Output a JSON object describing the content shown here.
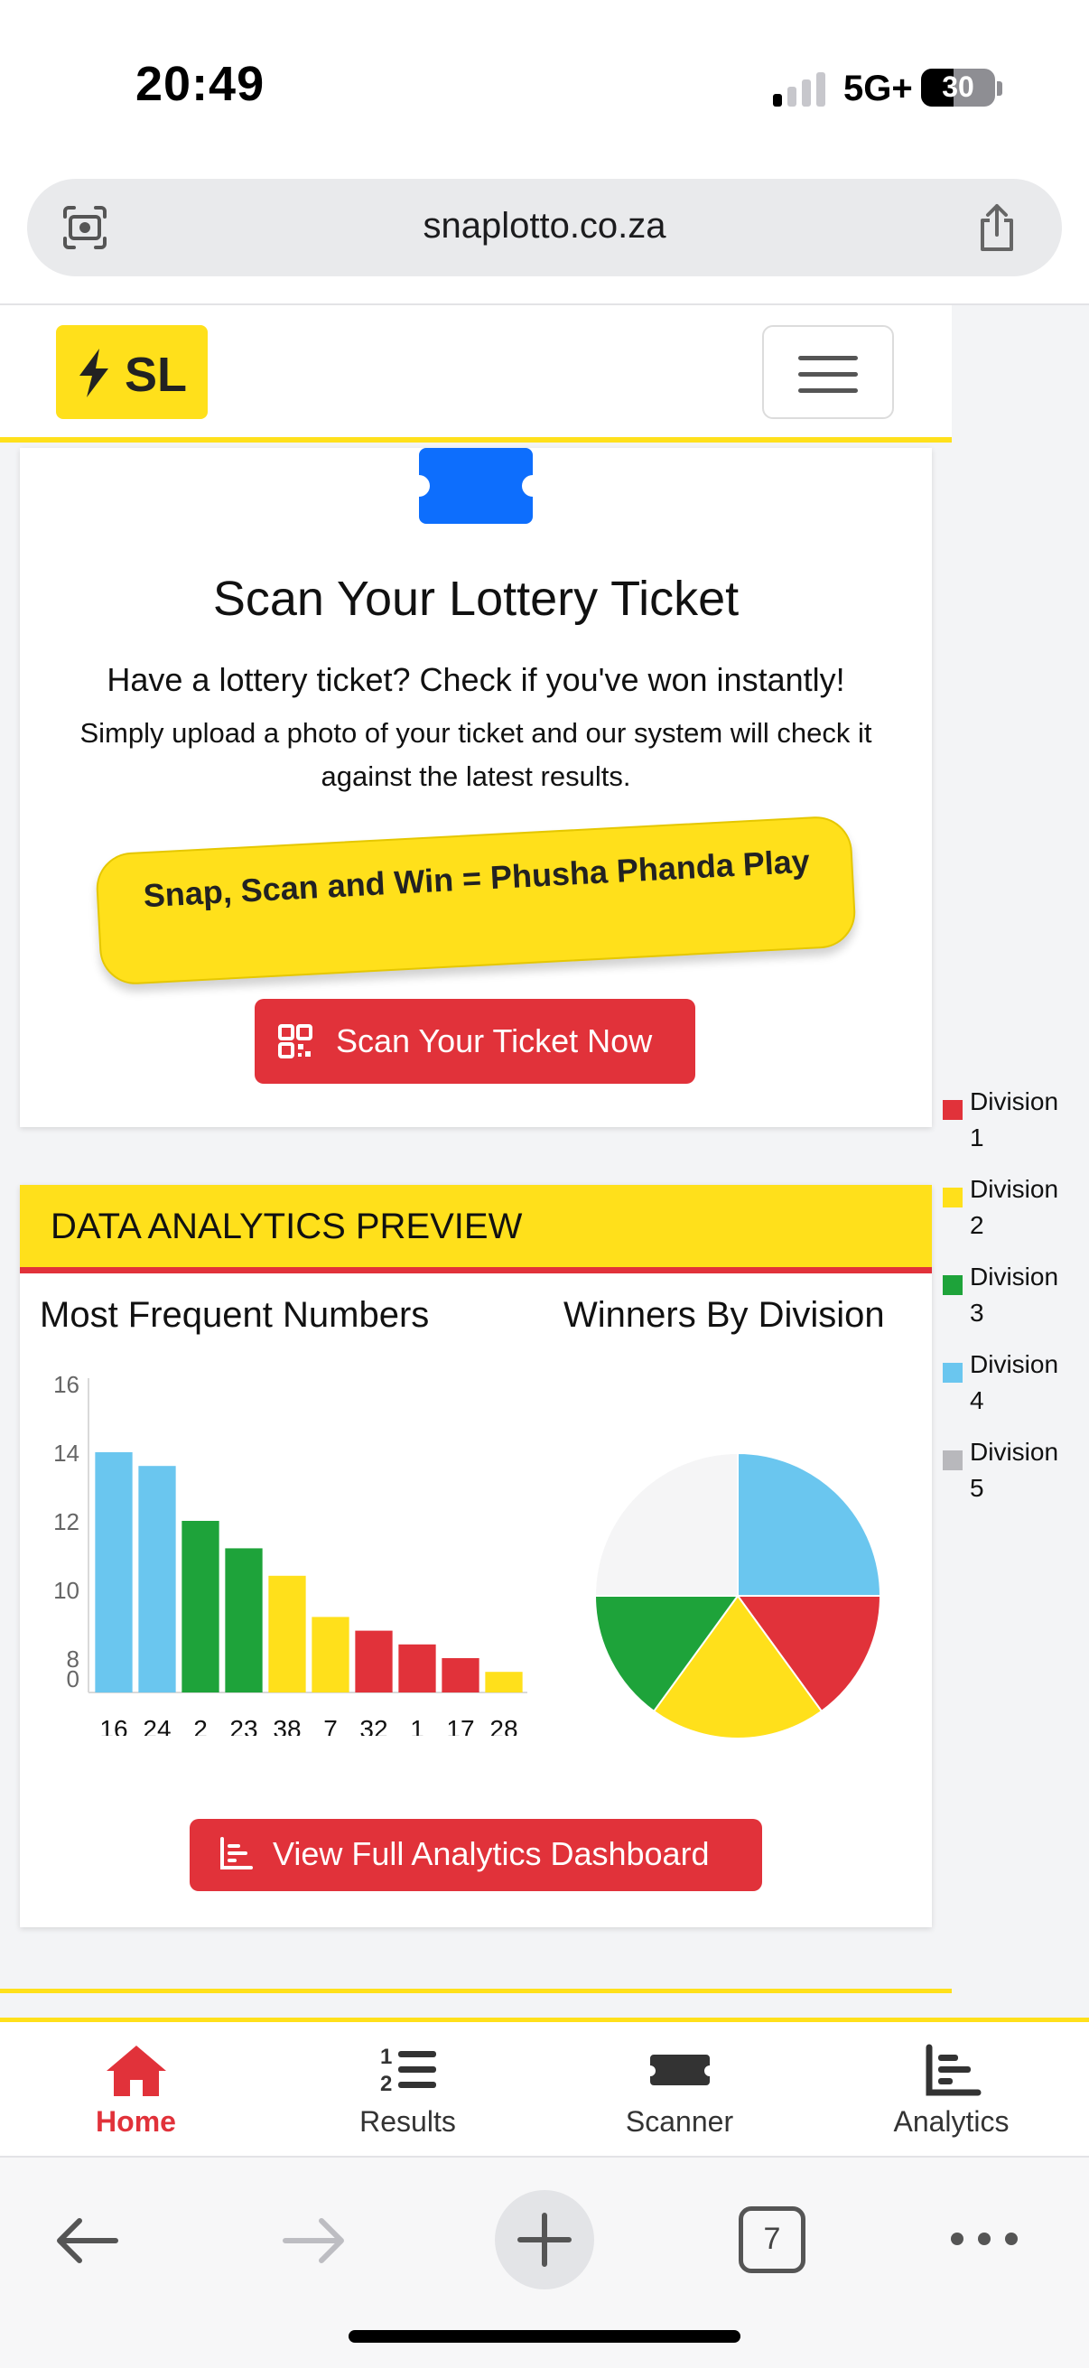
{
  "status_bar": {
    "time": "20:49",
    "network": "5G+",
    "battery": "30"
  },
  "browser": {
    "url": "snaplotto.co.za",
    "tab_count": "7",
    "icons": [
      "visual-search-icon",
      "share-icon",
      "back-arrow-icon",
      "forward-arrow-icon",
      "new-tab-plus-icon",
      "tabs-icon",
      "more-icon"
    ]
  },
  "site_nav": {
    "logo_text": "SL",
    "logo_color": "#ffe01b",
    "menu_icon": "hamburger-icon"
  },
  "scan_card": {
    "icon": "ticket-icon",
    "title": "Scan Your Lottery Ticket",
    "subtitle": "Have a lottery ticket? Check if you've won instantly!",
    "description": "Simply upload a photo of your ticket and our system will check it against the latest results.",
    "slogan": "Snap, Scan and Win = Phusha Phanda Play",
    "button_label": "Scan Your Ticket Now",
    "button_icon": "qr-code-icon"
  },
  "analytics": {
    "header": "DATA ANALYTICS PREVIEW",
    "left_title": "Most Frequent Numbers",
    "right_title": "Winners By Division",
    "button_label": "View Full Analytics Dashboard",
    "button_icon": "bar-chart-icon",
    "colors": {
      "blue": "#6ac6ef",
      "green": "#1ea33a",
      "yellow": "#ffe01b",
      "red": "#e1323a",
      "grey": "#b8b8bc",
      "empty": "#f5f5f6"
    }
  },
  "chart_data": [
    {
      "type": "bar",
      "title": "Most Frequent Numbers",
      "categories": [
        "16",
        "24",
        "2",
        "23",
        "38",
        "7",
        "32",
        "1",
        "17",
        "28"
      ],
      "values": [
        14,
        13.6,
        12,
        11.2,
        10.4,
        9.2,
        8.8,
        8.4,
        8.0,
        7.6
      ],
      "bar_colors": [
        "#6ac6ef",
        "#6ac6ef",
        "#1ea33a",
        "#1ea33a",
        "#ffe01b",
        "#ffe01b",
        "#e1323a",
        "#e1323a",
        "#e1323a",
        "#ffe01b"
      ],
      "y_ticks": [
        "16",
        "14",
        "12",
        "10",
        "8",
        "0"
      ],
      "ylim": [
        7,
        16
      ]
    },
    {
      "type": "pie",
      "title": "Winners By Division",
      "slices": [
        {
          "label": "Division 4",
          "value": 25,
          "color": "#6ac6ef"
        },
        {
          "label": "Division 1",
          "value": 15,
          "color": "#e1323a"
        },
        {
          "label": "Division 2",
          "value": 20,
          "color": "#ffe01b"
        },
        {
          "label": "Division 3",
          "value": 15,
          "color": "#1ea33a"
        },
        {
          "label": "Division 5",
          "value": 25,
          "color": "#f5f5f6"
        }
      ],
      "legend": [
        {
          "line1": "Division",
          "line2": "1",
          "color": "#e1323a"
        },
        {
          "line1": "Division",
          "line2": "2",
          "color": "#ffe01b"
        },
        {
          "line1": "Division",
          "line2": "3",
          "color": "#1ea33a"
        },
        {
          "line1": "Division",
          "line2": "4",
          "color": "#6ac6ef"
        },
        {
          "line1": "Division",
          "line2": "5",
          "color": "#b8b8bc"
        }
      ],
      "legend_position": "right"
    }
  ],
  "tab_nav": {
    "tabs": [
      {
        "label": "Home",
        "icon": "home-icon",
        "active": true
      },
      {
        "label": "Results",
        "icon": "numbered-list-icon",
        "active": false
      },
      {
        "label": "Scanner",
        "icon": "ticket-icon",
        "active": false
      },
      {
        "label": "Analytics",
        "icon": "bar-chart-icon",
        "active": false
      }
    ]
  }
}
